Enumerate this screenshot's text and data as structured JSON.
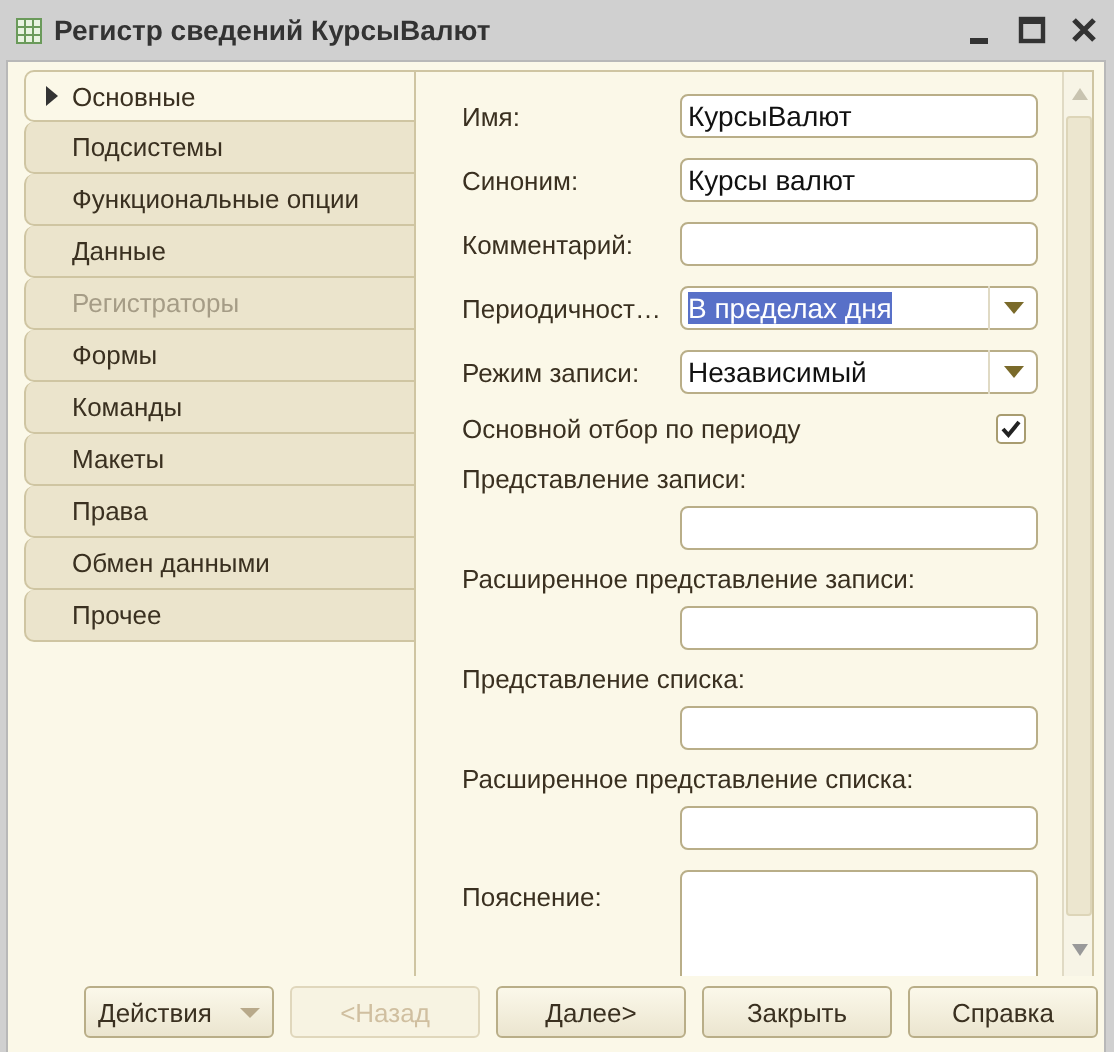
{
  "window": {
    "title": "Регистр сведений КурсыВалют"
  },
  "tabs": [
    {
      "label": "Основные",
      "selected": true,
      "disabled": false
    },
    {
      "label": "Подсистемы",
      "selected": false,
      "disabled": false
    },
    {
      "label": "Функциональные опции",
      "selected": false,
      "disabled": false
    },
    {
      "label": "Данные",
      "selected": false,
      "disabled": false
    },
    {
      "label": "Регистраторы",
      "selected": false,
      "disabled": true
    },
    {
      "label": "Формы",
      "selected": false,
      "disabled": false
    },
    {
      "label": "Команды",
      "selected": false,
      "disabled": false
    },
    {
      "label": "Макеты",
      "selected": false,
      "disabled": false
    },
    {
      "label": "Права",
      "selected": false,
      "disabled": false
    },
    {
      "label": "Обмен данными",
      "selected": false,
      "disabled": false
    },
    {
      "label": "Прочее",
      "selected": false,
      "disabled": false
    }
  ],
  "fields": [
    {
      "kind": "text",
      "label": "Имя:",
      "value": "КурсыВалют"
    },
    {
      "kind": "text",
      "label": "Синоним:",
      "value": "Курсы валют"
    },
    {
      "kind": "text",
      "label": "Комментарий:"
    },
    {
      "kind": "combo",
      "label": "Периодичност…",
      "value": "В пределах дня",
      "highlighted": true
    },
    {
      "kind": "combo",
      "label": "Режим записи:",
      "value": "Независимый",
      "highlighted": false
    },
    {
      "kind": "checkbox",
      "label": "Основной отбор по периоду",
      "checked": true
    },
    {
      "kind": "stacked",
      "label": "Представление записи:"
    },
    {
      "kind": "stacked",
      "label": "Расширенное представление записи:"
    },
    {
      "kind": "stacked",
      "label": "Представление списка:"
    },
    {
      "kind": "stacked",
      "label": "Расширенное представление списка:"
    },
    {
      "kind": "textarea",
      "label": "Пояснение:"
    }
  ],
  "buttons": [
    {
      "label": "Действия",
      "kind": "menu",
      "disabled": false
    },
    {
      "label": "<Назад",
      "kind": "plain",
      "disabled": true
    },
    {
      "label": "Далее>",
      "kind": "plain",
      "disabled": false
    },
    {
      "label": "Закрыть",
      "kind": "plain",
      "disabled": false
    },
    {
      "label": "Справка",
      "kind": "plain",
      "disabled": false
    }
  ]
}
